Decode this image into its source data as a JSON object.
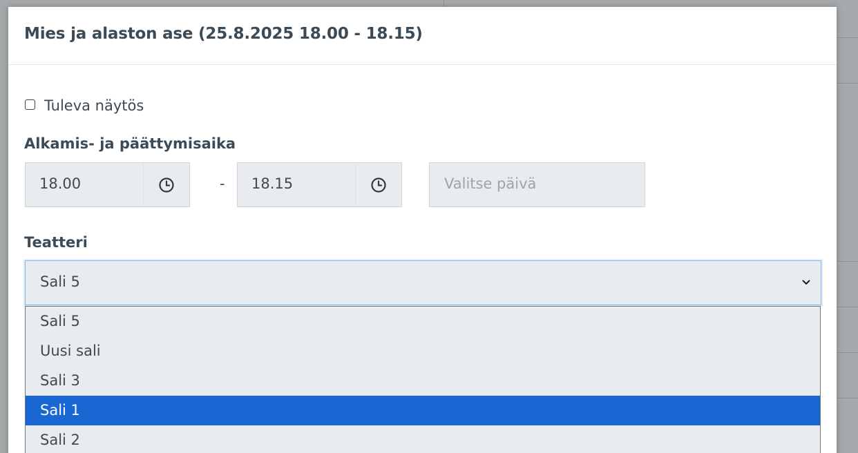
{
  "modal": {
    "title": "Mies ja alaston ase (25.8.2025 18.00 - 18.15)"
  },
  "form": {
    "upcoming_checkbox": {
      "label": "Tuleva näytös",
      "checked": false
    },
    "time_section": {
      "label": "Alkamis- ja päättymisaika",
      "start_time": "18.00",
      "separator": "-",
      "end_time": "18.15",
      "start_icon": "clock-icon",
      "end_icon": "clock-icon",
      "date_placeholder": "Valitse päivä"
    },
    "theater_section": {
      "label": "Teatteri",
      "selected_value": "Sali 5",
      "chevron_icon": "chevron-down-icon"
    }
  },
  "dropdown": {
    "options": [
      {
        "label": "Sali 5"
      },
      {
        "label": "Uusi sali"
      },
      {
        "label": "Sali 3"
      },
      {
        "label": "Sali 1"
      },
      {
        "label": "Sali 2"
      }
    ],
    "highlighted_index": 3
  },
  "colors": {
    "text": "#3b4a54",
    "input_bg": "#e9ecef",
    "highlight": "#1967d2",
    "focus_border": "#86b7e9"
  }
}
